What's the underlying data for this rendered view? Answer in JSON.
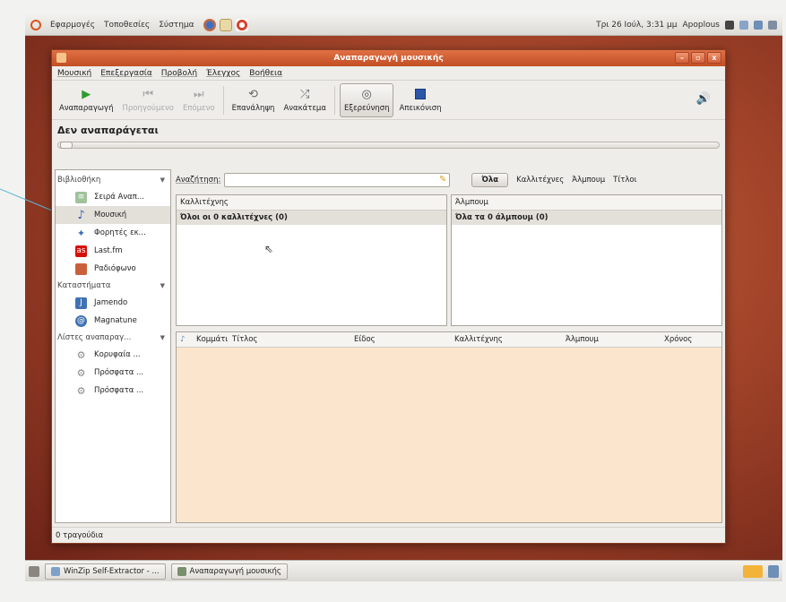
{
  "top_panel": {
    "menus": [
      "Εφαρμογές",
      "Τοποθεσίες",
      "Σύστημα"
    ],
    "clock": "Τρι 26 Ιούλ, 3:31 μμ",
    "user": "Apoplous"
  },
  "window": {
    "title": "Αναπαραγωγή μουσικής",
    "controls": [
      "–",
      "▫",
      "x"
    ],
    "menubar": [
      "Μουσική",
      "Επεξεργασία",
      "Προβολή",
      "Έλεγχος",
      "Βοήθεια"
    ],
    "toolbar": {
      "play": "Αναπαραγωγή",
      "previous": "Προηγούμενο",
      "next": "Επόμενο",
      "repeat": "Επανάληψη",
      "shuffle": "Ανακάτεμα",
      "browse": "Εξερεύνηση",
      "visualization": "Απεικόνιση"
    },
    "now_playing": "Δεν αναπαράγεται",
    "sidebar": {
      "groups": [
        {
          "label": "Βιβλιοθήκη",
          "items": [
            "Σειρά Αναπ...",
            "Μουσική",
            "Φορητές εκ...",
            "Last.fm",
            "Ραδιόφωνο"
          ]
        },
        {
          "label": "Καταστήματα",
          "items": [
            "Jamendo",
            "Magnatune"
          ]
        },
        {
          "label": "Λίστες αναπαραγ...",
          "items": [
            "Κορυφαία ...",
            "Πρόσφατα ...",
            "Πρόσφατα ..."
          ]
        }
      ],
      "selected": "Μουσική"
    },
    "search": {
      "label": "Αναζήτηση:",
      "value": "",
      "filters": [
        "Όλα",
        "Καλλιτέχνες",
        "Άλμπουμ",
        "Τίτλοι"
      ],
      "active_filter": "Όλα"
    },
    "artist_browser": {
      "header": "Καλλιτέχνης",
      "row": "Όλοι οι 0 καλλιτέχνες (0)"
    },
    "album_browser": {
      "header": "Άλμπουμ",
      "row": "Όλα τα 0 άλμπουμ (0)"
    },
    "track_columns": [
      "Κομμάτι",
      "Τίτλος",
      "Είδος",
      "Καλλιτέχνης",
      "Άλμπουμ",
      "Χρόνος"
    ],
    "status": "0 τραγούδια"
  },
  "bottom_panel": {
    "tasks": [
      "WinZip Self-Extractor - ...",
      "Αναπαραγωγή μουσικής"
    ]
  },
  "colors": {
    "titlebar": "#d25c30",
    "desktop": "#a4452a",
    "track_pane": "#fbe5cc",
    "callout": "#5bb6d6"
  }
}
